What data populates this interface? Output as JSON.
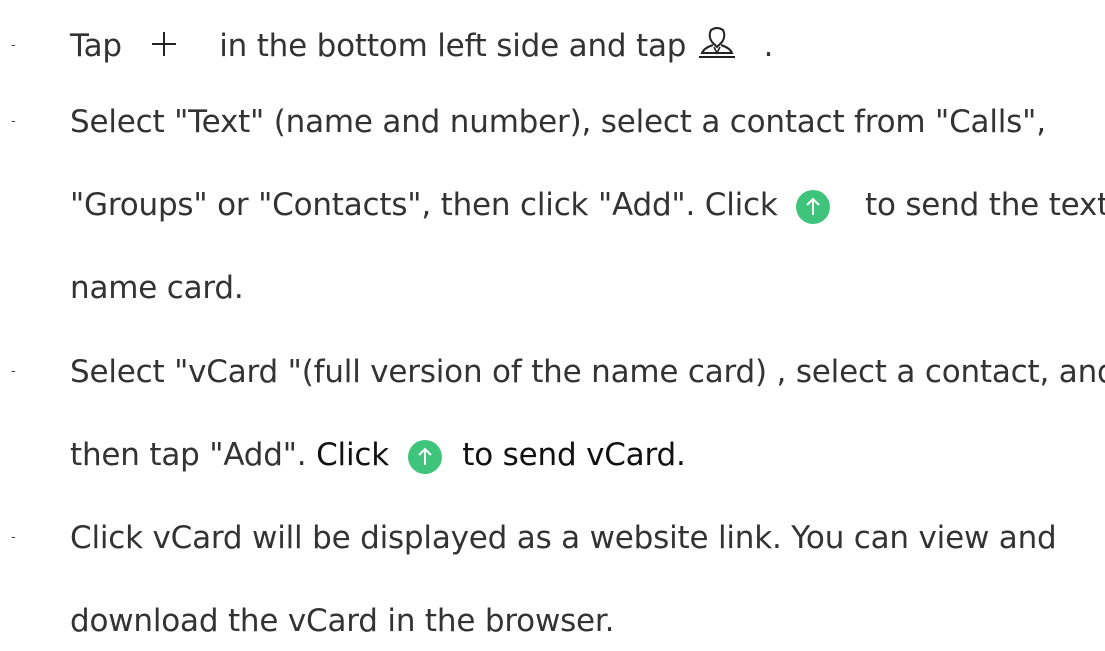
{
  "bullet_glyph": "-",
  "icons": {
    "plus": "plus-icon",
    "person": "person-icon",
    "send": "arrow-up-circle-icon",
    "send_color": "#3fc57b"
  },
  "items": [
    {
      "part1": "Tap",
      "part2": "in the bottom left side and tap",
      "part3": "."
    },
    {
      "line1": "Select \"Text\" (name and number), select a contact from \"Calls\",",
      "line2a": "\"Groups\" or \"Contacts\", then click \"Add\". Click",
      "line2b": "to send the text",
      "line3": "name card."
    },
    {
      "line1": "Select \"vCard \"(full version of the name card) , select a contact, and",
      "line2a": "then tap \"Add\".",
      "line2b": "Click",
      "line2c": "to send vCard."
    },
    {
      "line1": "Click vCard will be displayed as a website link. You can view and",
      "line2": "download the vCard in the browser."
    }
  ]
}
